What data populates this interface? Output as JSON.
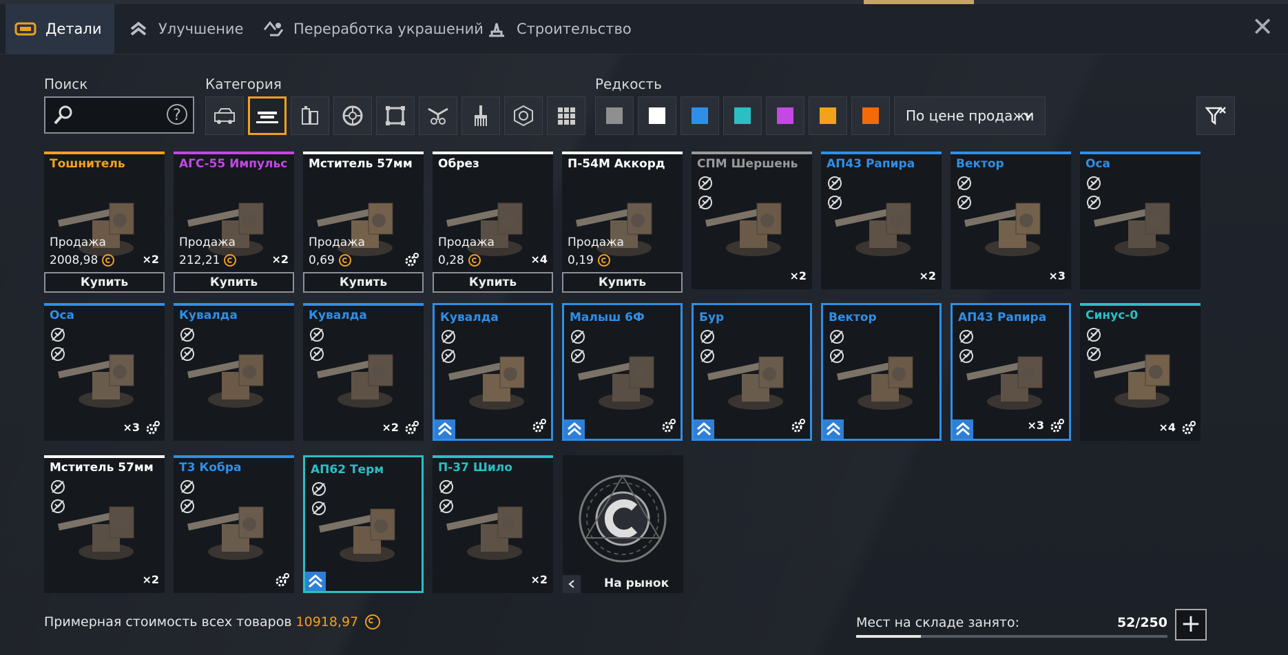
{
  "tabs": [
    {
      "label": "Детали",
      "icon": "parts-icon",
      "active": true
    },
    {
      "label": "Улучшение",
      "icon": "upgrade-icon",
      "active": false
    },
    {
      "label": "Переработка украшений",
      "icon": "recycle-icon",
      "active": false
    },
    {
      "label": "Строительство",
      "icon": "build-icon",
      "active": false
    }
  ],
  "filters": {
    "search_label": "Поиск",
    "search_value": "",
    "category_label": "Категория",
    "categories": [
      "cabin-icon",
      "weapon-icon",
      "module-icon",
      "wheel-icon",
      "frame-icon",
      "decor-icon",
      "paint-icon",
      "resource-icon",
      "grid-icon"
    ],
    "rarity_label": "Редкость",
    "rarities": [
      "#8f8f8f",
      "#ffffff",
      "#2f8fe8",
      "#2bbfc4",
      "#c447e6",
      "#f2a21c",
      "#f26a0a"
    ],
    "sort_value": "По цене продажи"
  },
  "cards": [
    {
      "name": "Тошнитель",
      "color": "#f2a21c",
      "sale": "Продажа",
      "price": "2008,98",
      "qty": "×2",
      "buy": "Купить"
    },
    {
      "name": "АГС-55 Импульс",
      "color": "#c447e6",
      "sale": "Продажа",
      "price": "212,21",
      "qty": "×2",
      "buy": "Купить"
    },
    {
      "name": "Мститель 57мм",
      "color": "#ffffff",
      "sale": "Продажа",
      "price": "0,69",
      "qty": "",
      "buy": "Купить"
    },
    {
      "name": "Обрез",
      "color": "#ffffff",
      "sale": "Продажа",
      "price": "0,28",
      "qty": "×4",
      "buy": "Купить"
    },
    {
      "name": "П-54М Аккорд",
      "color": "#ffffff",
      "sale": "Продажа",
      "price": "0,19",
      "qty": "",
      "buy": "Купить"
    },
    {
      "name": "СПМ Шершень",
      "color": "#9a9a9a",
      "qty": "×2"
    },
    {
      "name": "АП43 Рапира",
      "color": "#2f8fe8",
      "qty": "×2"
    },
    {
      "name": "Вектор",
      "color": "#2f8fe8",
      "qty": "×3"
    },
    {
      "name": "Оса",
      "color": "#2f8fe8",
      "qty": ""
    },
    {
      "name": "Оса",
      "color": "#2f8fe8",
      "qty": "×3"
    },
    {
      "name": "Кувалда",
      "color": "#2f8fe8",
      "qty": ""
    },
    {
      "name": "Кувалда",
      "color": "#2f8fe8",
      "qty": "×2"
    },
    {
      "name": "Кувалда",
      "color": "#2f8fe8",
      "qty": ""
    },
    {
      "name": "Малыш 6Ф",
      "color": "#2f8fe8",
      "qty": ""
    },
    {
      "name": "Бур",
      "color": "#2f8fe8",
      "qty": ""
    },
    {
      "name": "Вектор",
      "color": "#2f8fe8",
      "qty": ""
    },
    {
      "name": "АП43 Рапира",
      "color": "#2f8fe8",
      "qty": "×3"
    },
    {
      "name": "Синус-0",
      "color": "#2bbfc4",
      "qty": "×4"
    },
    {
      "name": "Мститель 57мм",
      "color": "#ffffff",
      "qty": "×2"
    },
    {
      "name": "Т3 Кобра",
      "color": "#2f8fe8",
      "qty": ""
    },
    {
      "name": "АП62 Терм",
      "color": "#2bbfc4",
      "qty": ""
    },
    {
      "name": "П-37 Шило",
      "color": "#2bbfc4",
      "qty": "×2"
    }
  ],
  "market_label": "На рынок",
  "footer": {
    "cost_label": "Примерная стоимость всех товаров",
    "cost_value": "10918,97",
    "storage_label": "Мест на складе занято:",
    "storage_value": "52/250",
    "storage_fraction": 0.208
  }
}
